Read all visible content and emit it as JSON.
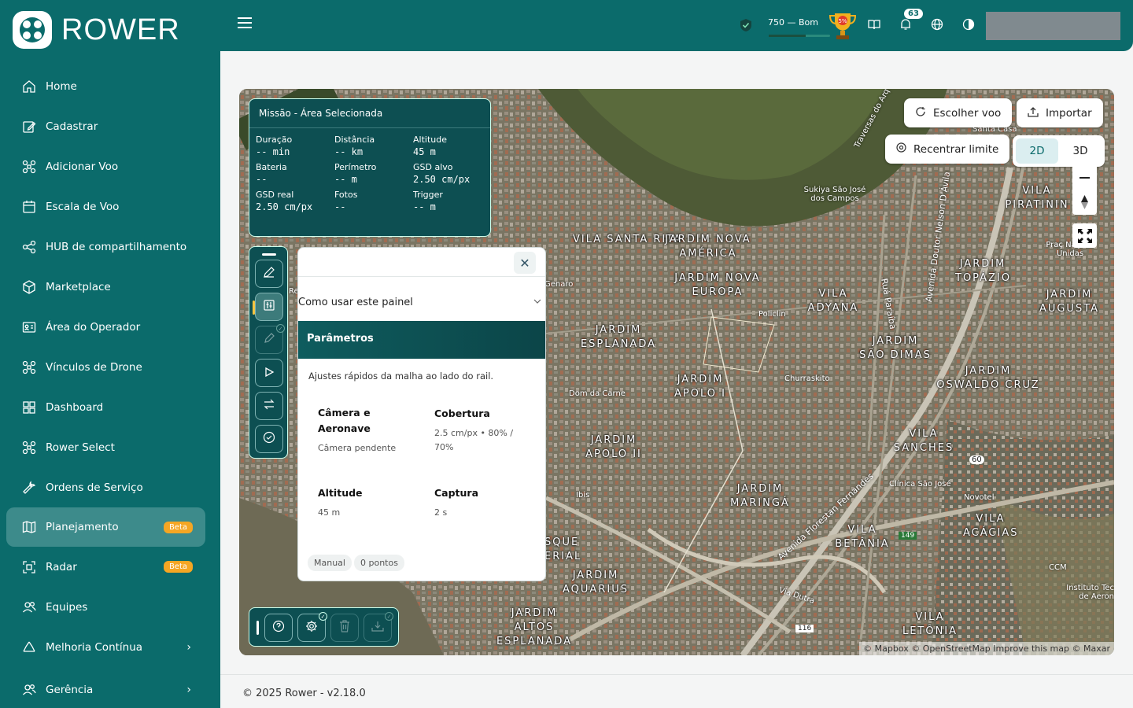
{
  "app": {
    "name": "ROWER"
  },
  "sidebar": {
    "items": [
      {
        "label": "Home",
        "icon": "home-icon"
      },
      {
        "label": "Cadastrar",
        "icon": "edit-icon"
      },
      {
        "label": "Adicionar Voo",
        "icon": "drone-icon"
      },
      {
        "label": "Escala de Voo",
        "icon": "calendar-icon"
      },
      {
        "label": "HUB de compartilhamento",
        "icon": "share-icon"
      },
      {
        "label": "Marketplace",
        "icon": "box-icon"
      },
      {
        "label": "Área do Operador",
        "icon": "id-card-icon"
      },
      {
        "label": "Vínculos de Drone",
        "icon": "drone-icon"
      },
      {
        "label": "Dashboard",
        "icon": "grid-icon"
      },
      {
        "label": "Rower Select",
        "icon": "drone-icon"
      },
      {
        "label": "Ordens de Serviço",
        "icon": "wrench-icon"
      },
      {
        "label": "Planejamento",
        "icon": "map-icon",
        "badge": "Beta",
        "active": true
      },
      {
        "label": "Radar",
        "icon": "radar-icon",
        "badge": "Beta"
      },
      {
        "label": "Equipes",
        "icon": "users-icon"
      },
      {
        "label": "Melhoria Contínua",
        "icon": "recycle-icon"
      },
      {
        "label": "Gerência",
        "icon": "users-icon"
      }
    ]
  },
  "header": {
    "score_text": "750 — Bom",
    "score_progress": 0.6,
    "trophy_percent": "5%",
    "notifications": "63"
  },
  "mission": {
    "title": "Missão - Área Selecionada",
    "fields": [
      {
        "key": "Duração",
        "value": "-- min"
      },
      {
        "key": "Distância",
        "value": "-- km"
      },
      {
        "key": "Altitude",
        "value": "45 m"
      },
      {
        "key": "Bateria",
        "value": "--"
      },
      {
        "key": "Perímetro",
        "value": "-- m"
      },
      {
        "key": "GSD alvo",
        "value": "2.50 cm/px"
      },
      {
        "key": "GSD real",
        "value": "2.50 cm/px"
      },
      {
        "key": "Fotos",
        "value": "--"
      },
      {
        "key": "Trigger",
        "value": "-- m"
      }
    ]
  },
  "help": {
    "how_to": "Como usar este painel",
    "section": "Parâmetros",
    "subtitle": "Ajustes rápidos da malha ao lado do rail.",
    "camera_title": "Câmera e Aeronave",
    "camera_desc": "Câmera pendente",
    "coverage_title": "Cobertura",
    "coverage_desc": "2.5 cm/px • 80% / 70%",
    "altitude_title": "Altitude",
    "altitude_desc": "45 m",
    "capture_title": "Captura",
    "capture_desc": "2 s",
    "chip_manual": "Manual",
    "chip_points": "0 pontos"
  },
  "map_controls": {
    "choose_flight": "Escolher voo",
    "import": "Importar",
    "recenter": "Recentrar limite",
    "mode_2d": "2D",
    "mode_3d": "3D",
    "selected_mode": "2D"
  },
  "map_labels": {
    "neighborhoods": [
      "VILA SANTA RITA",
      "JARDIM NOVA AMÉRICA",
      "JARDIM NOVA EUROPA",
      "VILA ADYANA",
      "JARDIM ESPLANADA",
      "JARDIM SÃO DIMAS",
      "JARDIM APOLO I",
      "JARDIM APOLO II",
      "JARDIM OSWALDO CRUZ",
      "VILA SANCHES",
      "JARDIM MARINGÁ",
      "VILA BETÂNIA",
      "VILA ACÁCIAS",
      "JARDIM AQUARIUS",
      "JARDIM ALTOS ESPLANADA",
      "VILA LETÔNIA",
      "VILA PIRATININ",
      "JARDIM TOPÁZIO",
      "JARDIM AUGUSTA",
      "SQUE ERIAL"
    ],
    "pois": [
      "Sukiya São José dos Campos",
      "Policlin",
      "Churraskito",
      "Dom da Carne",
      "Ibis",
      "Clínica São José",
      "Novotel",
      "CCM",
      "Instituto Tec de Aeron",
      "Santa Casa",
      "Praç Nações Unidas",
      "Genaro",
      "Re"
    ],
    "roads": [
      "Ruá Paraíba",
      "Avenida Doutor Nelson D'Ávila",
      "Avenida Florestan Fernandes",
      "Traversas do Arq",
      "Via Dutra"
    ],
    "shields": [
      "60",
      "149",
      "116"
    ],
    "attribution": "© Mapbox © OpenStreetMap Improve this map © Maxar"
  },
  "footer": {
    "text": "© 2025 Rower - v2.18.0"
  },
  "colors": {
    "primary": "#0b6b6b",
    "panel": "#0d4f52",
    "beta": "#f5a623"
  }
}
